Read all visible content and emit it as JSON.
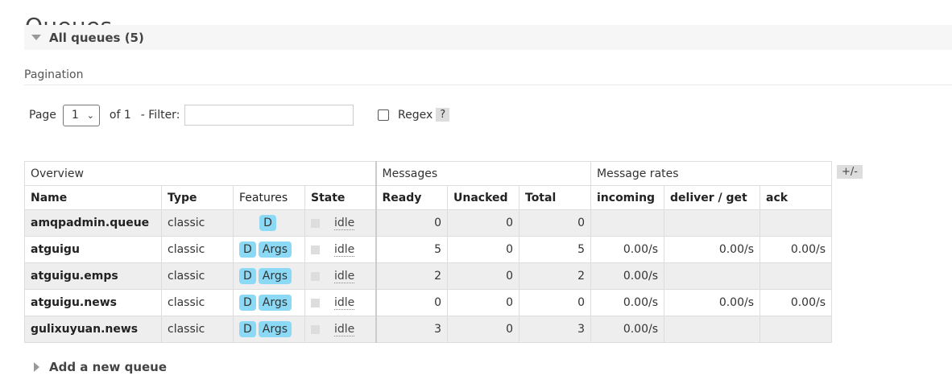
{
  "page": {
    "title": "Queues"
  },
  "section": {
    "title": "All queues (5)"
  },
  "pagination": {
    "label": "Pagination",
    "page_label": "Page",
    "page_value": "1",
    "of_label": "of 1",
    "filter_label": "- Filter:",
    "filter_value": "",
    "regex_label": "Regex",
    "regex_checked": false,
    "help_label": "?"
  },
  "table": {
    "groups": {
      "overview": "Overview",
      "messages": "Messages",
      "rates": "Message rates"
    },
    "columns": [
      "Name",
      "Type",
      "Features",
      "State",
      "Ready",
      "Unacked",
      "Total",
      "incoming",
      "deliver / get",
      "ack"
    ],
    "plus_minus": "+/-",
    "rows": [
      {
        "name": "amqpadmin.queue",
        "type": "classic",
        "features": [
          "D"
        ],
        "state": "idle",
        "ready": "0",
        "unacked": "0",
        "total": "0",
        "incoming": "",
        "deliver": "",
        "ack": ""
      },
      {
        "name": "atguigu",
        "type": "classic",
        "features": [
          "D",
          "Args"
        ],
        "state": "idle",
        "ready": "5",
        "unacked": "0",
        "total": "5",
        "incoming": "0.00/s",
        "deliver": "0.00/s",
        "ack": "0.00/s"
      },
      {
        "name": "atguigu.emps",
        "type": "classic",
        "features": [
          "D",
          "Args"
        ],
        "state": "idle",
        "ready": "2",
        "unacked": "0",
        "total": "2",
        "incoming": "0.00/s",
        "deliver": "",
        "ack": ""
      },
      {
        "name": "atguigu.news",
        "type": "classic",
        "features": [
          "D",
          "Args"
        ],
        "state": "idle",
        "ready": "0",
        "unacked": "0",
        "total": "0",
        "incoming": "0.00/s",
        "deliver": "0.00/s",
        "ack": "0.00/s"
      },
      {
        "name": "gulixuyuan.news",
        "type": "classic",
        "features": [
          "D",
          "Args"
        ],
        "state": "idle",
        "ready": "3",
        "unacked": "0",
        "total": "3",
        "incoming": "0.00/s",
        "deliver": "",
        "ack": ""
      }
    ]
  },
  "add_queue": {
    "label": "Add a new queue"
  },
  "icons": {
    "collapse": "triangle-down-icon",
    "expand": "triangle-right-icon",
    "dropdown": "chevron-down-icon"
  },
  "colors": {
    "feature_tag": "#8cd9f5",
    "row_alt": "#eeeeee"
  }
}
